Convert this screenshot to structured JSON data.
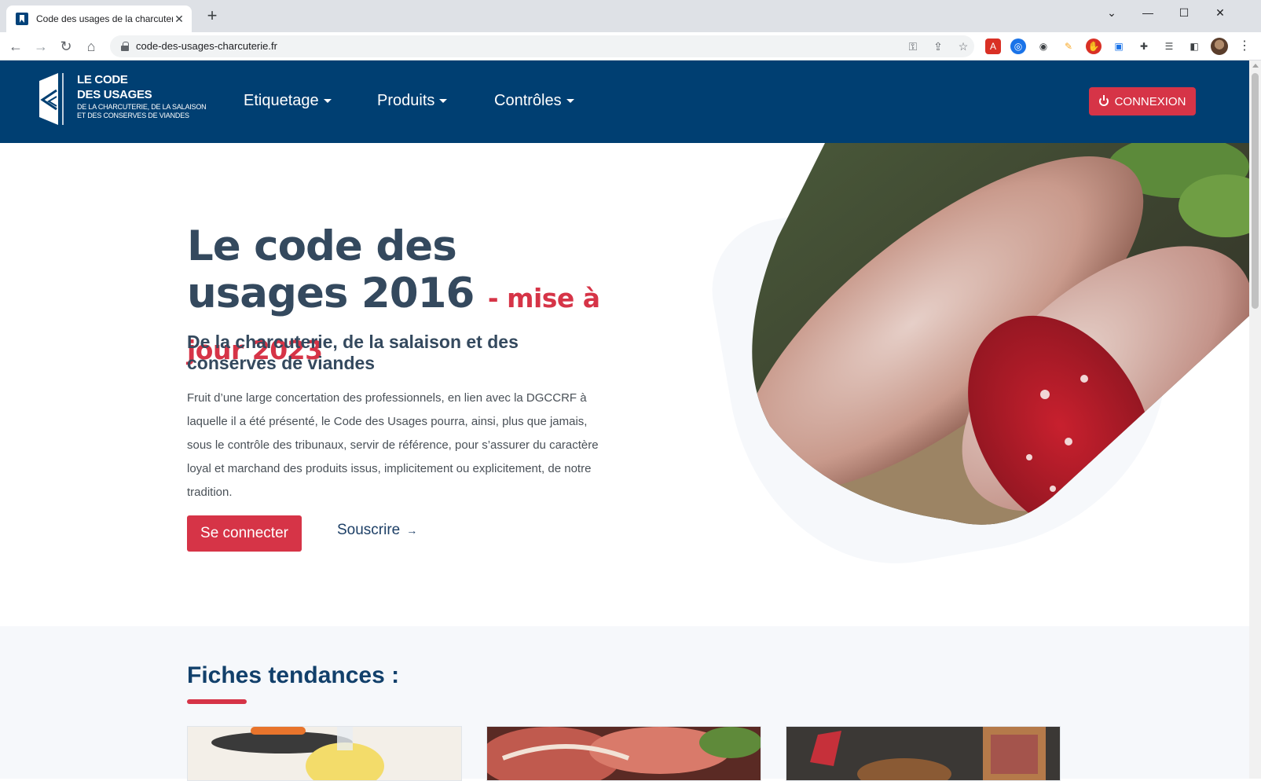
{
  "browser": {
    "tab_title": "Code des usages de la charcuterie",
    "tab_close": "✕",
    "new_tab": "+",
    "url": "code-des-usages-charcuterie.fr",
    "window_controls": [
      "⌄",
      "—",
      "☐",
      "✕"
    ],
    "icons": [
      "key-icon",
      "share-icon",
      "star-icon",
      "pdf-extension-icon",
      "edge-extension-icon",
      "spy-extension-icon",
      "pencil-extension-icon",
      "adblock-extension-icon",
      "screen-extension-icon",
      "puzzle-icon",
      "reading-list-icon",
      "side-panel-icon",
      "profile-avatar",
      "menu-kebab-icon"
    ]
  },
  "header": {
    "logo": {
      "line1": "LE CODE",
      "line2": "DES USAGES",
      "line3": "DE LA CHARCUTERIE, DE LA SALAISON",
      "line4": "ET DES CONSERVES DE VIANDES"
    },
    "menu": [
      {
        "label": "Etiquetage"
      },
      {
        "label": "Produits"
      },
      {
        "label": "Contrôles"
      }
    ],
    "connexion_label": "CONNEXION",
    "brand_color": "#003f72",
    "accent_color": "#d63447"
  },
  "hero": {
    "title": "Le code des usages 2016",
    "update": "- mise à jour 2023",
    "subtitle": "De la charcuterie, de la salaison et des conserves de viandes",
    "text": "Fruit d’une large concertation des professionnels, en lien avec la DGCCRF à laquelle il a été présenté, le Code des Usages pourra, ainsi, plus que jamais, sous le contrôle des tribunaux, servir de référence, pour s’assurer du caractère loyal et marchand des produits issus, implicitement ou explicitement, de notre tradition.",
    "primary_button": "Se connecter",
    "link_button": "Souscrire",
    "link_arrow": "→"
  },
  "trending": {
    "title": "Fiches tendances :"
  }
}
